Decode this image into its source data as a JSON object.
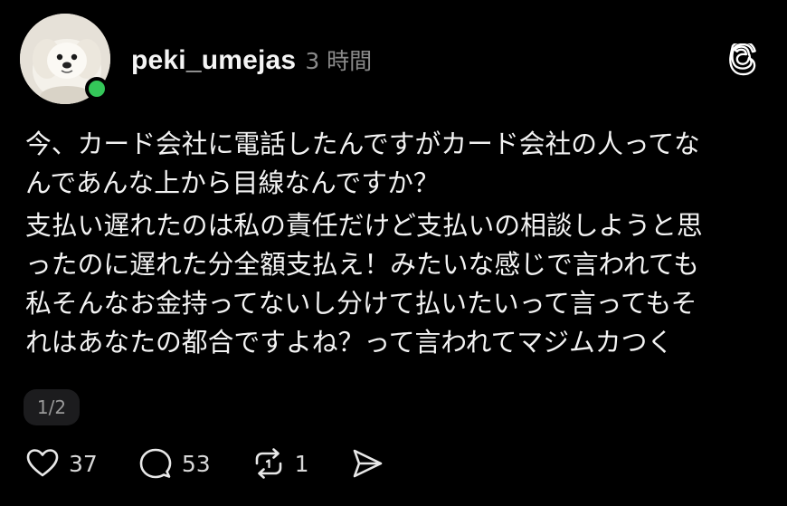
{
  "post": {
    "username": "peki_umejas",
    "timestamp": "3 時間",
    "lines_p1": [
      "今、カード会社に電話したんですがカード会社の人ってな",
      "んであんな上から目線なんですか？"
    ],
    "lines_p2": [
      "支払い遅れたのは私の責任だけど支払いの相談しようと思",
      "ったのに遅れた分全額支払え！みたいな感じで言われても",
      "私そんなお金持ってないし分けて払いたいって言ってもそ",
      "れはあなたの都合ですよね？って言われてマジムカつく"
    ],
    "page_indicator": "1/2"
  },
  "actions": {
    "like": {
      "icon": "heart-icon",
      "count": "37"
    },
    "reply": {
      "icon": "comment-icon",
      "count": "53"
    },
    "repost": {
      "icon": "repost-icon",
      "count": "1"
    },
    "share": {
      "icon": "send-icon"
    }
  },
  "colors": {
    "background": "#000000",
    "text": "#f3f3f3",
    "muted": "#8a8a8a",
    "online": "#34c759"
  }
}
